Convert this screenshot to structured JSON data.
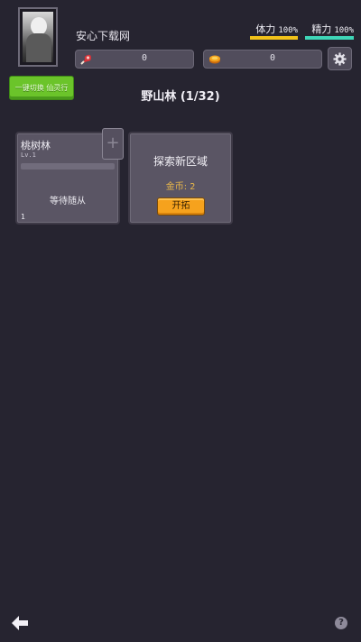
{
  "player": {
    "name": "安心下载网",
    "avatar_icon": "character-portrait"
  },
  "stats": {
    "stamina": {
      "label": "体力",
      "percent": 100,
      "percent_text": "100%",
      "color": "#f2c21a"
    },
    "energy": {
      "label": "精力",
      "percent": 100,
      "percent_text": "100%",
      "color": "#3fd6b8"
    }
  },
  "resources": {
    "meat": {
      "icon": "meat-icon",
      "value": "0"
    },
    "gold": {
      "icon": "gold-coin-icon",
      "value": "0"
    }
  },
  "settings": {
    "icon": "gear-icon"
  },
  "green_button": {
    "label": "一键切换 仙灵行"
  },
  "area": {
    "title": "野山林 (1/32)"
  },
  "cards": {
    "forest": {
      "name": "桃树林",
      "level": "Lv.1",
      "status": "等待随从",
      "count": "1",
      "add_label": "+"
    },
    "explore": {
      "title": "探索新区域",
      "cost_label": "金币:",
      "cost_value": "2",
      "button_label": "开拓"
    }
  },
  "footer": {
    "back_icon": "arrow-left-icon",
    "help_label": "?"
  }
}
